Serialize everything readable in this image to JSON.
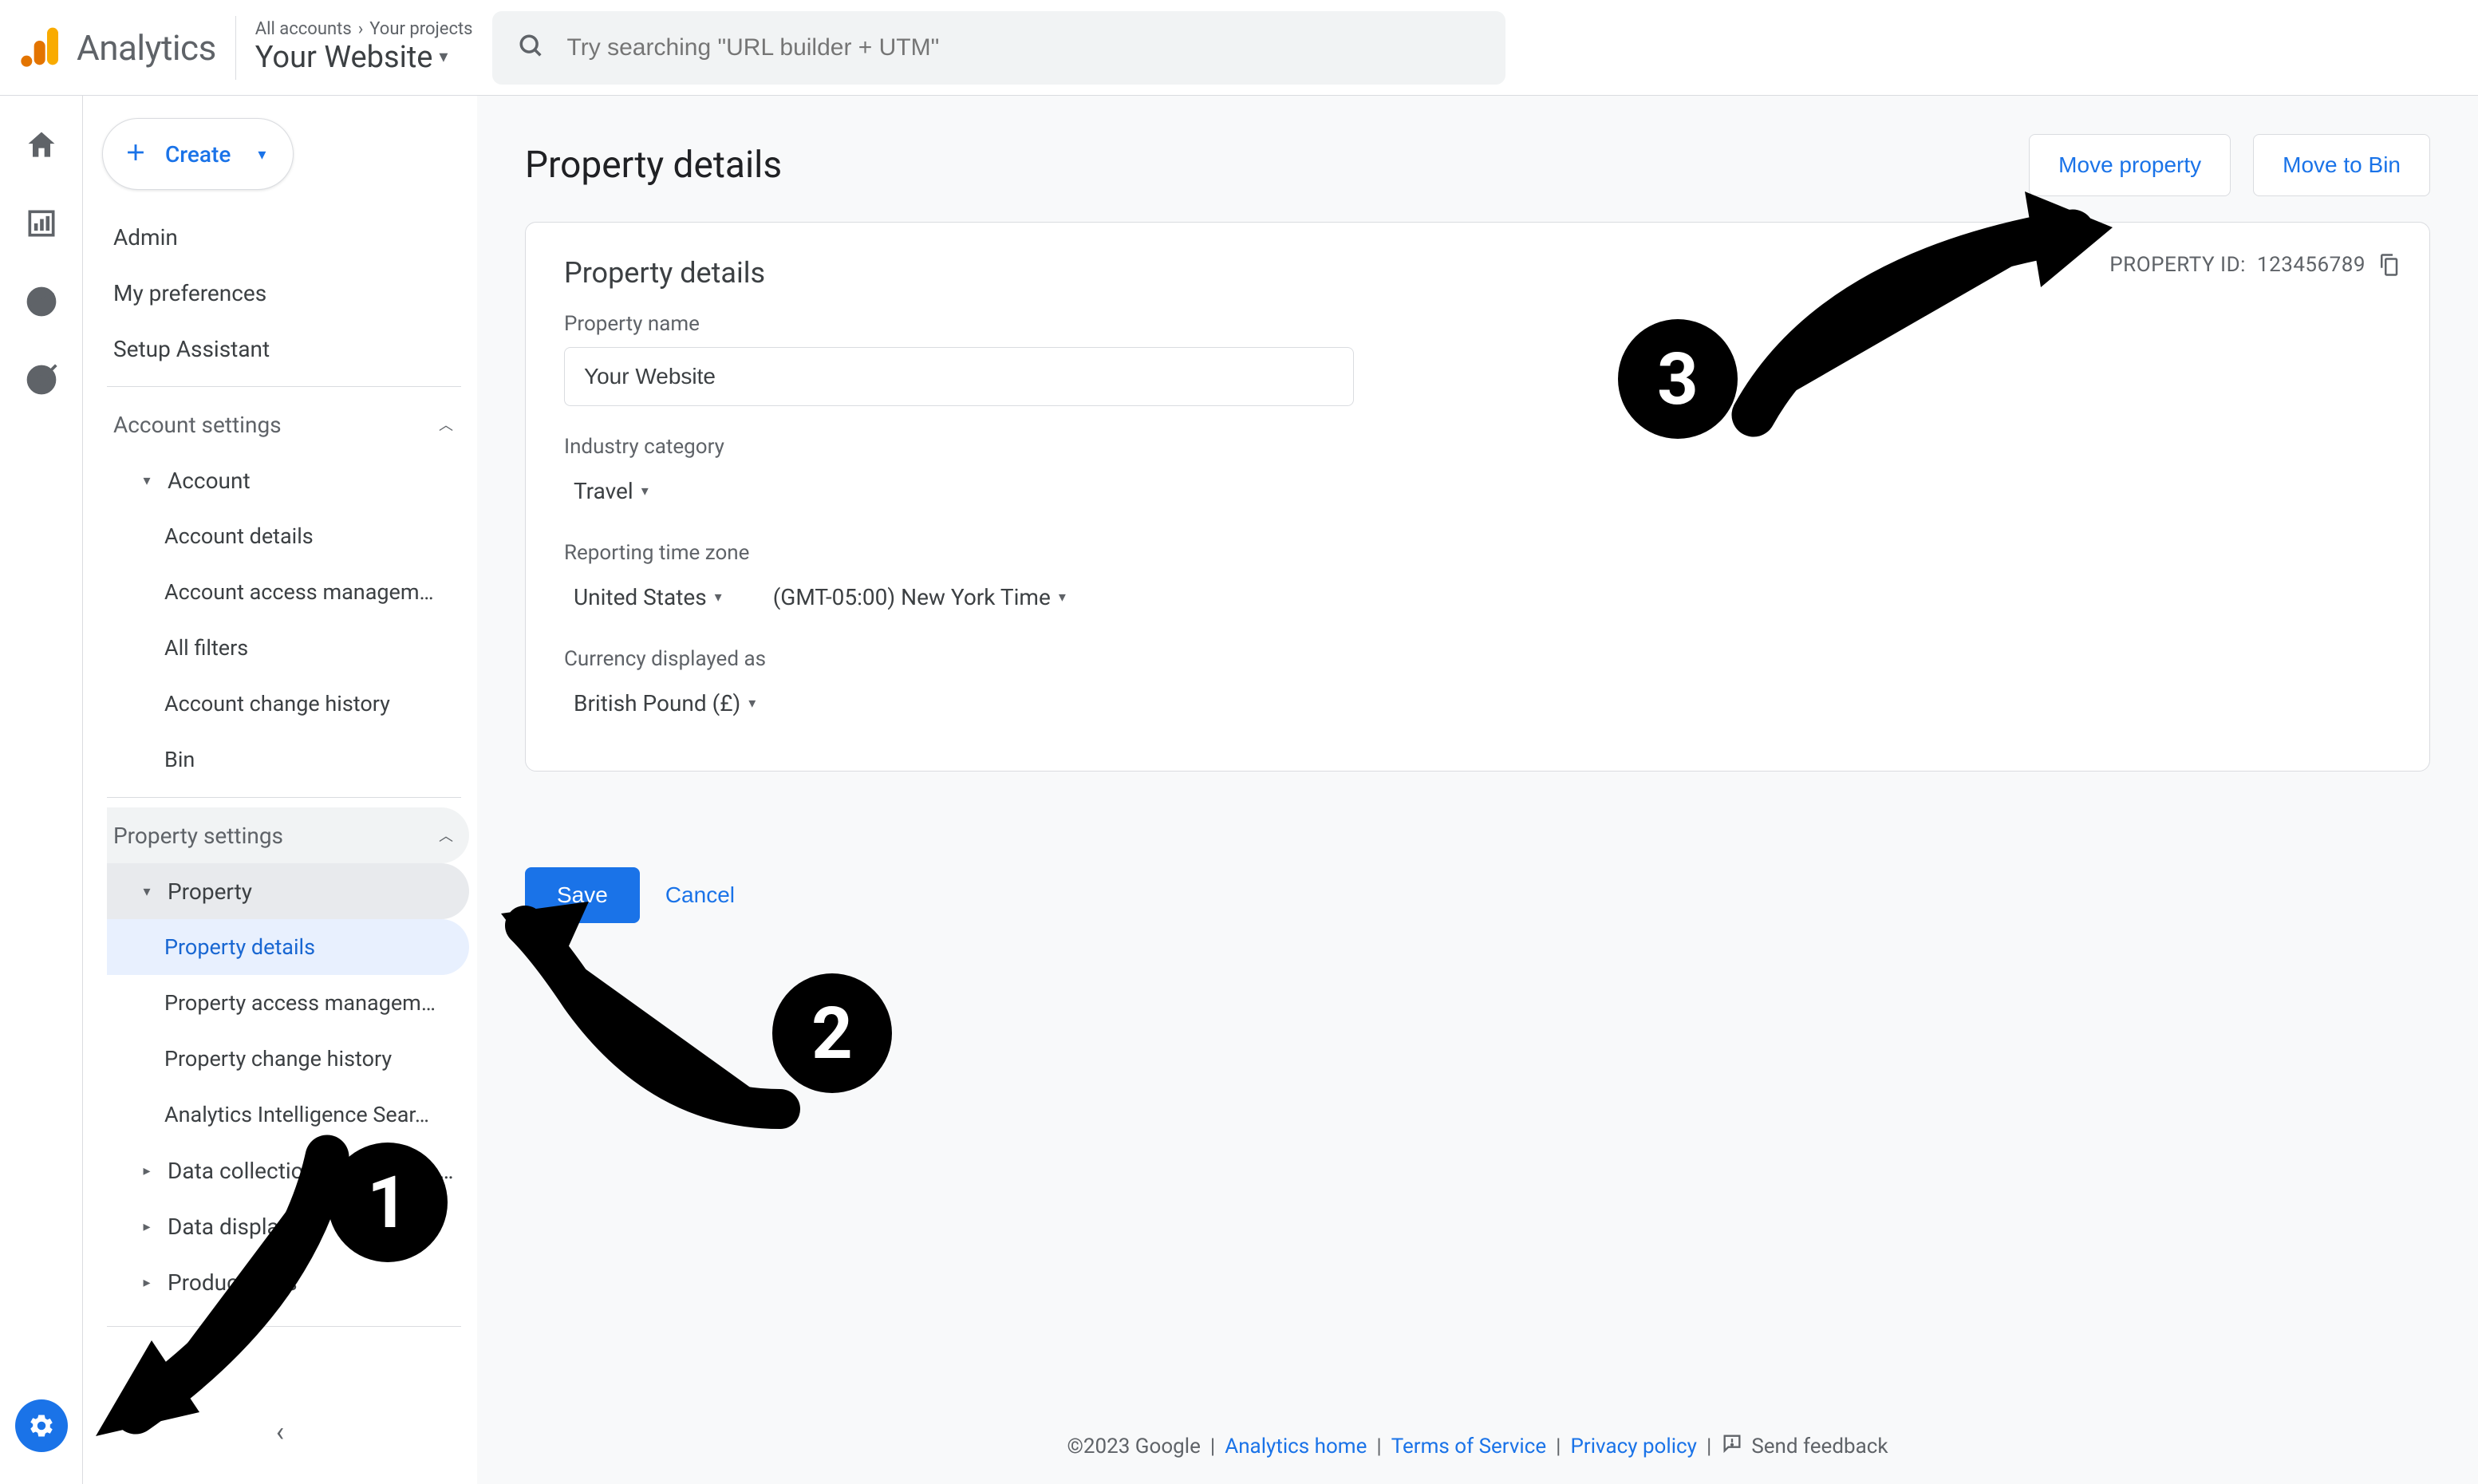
{
  "brand": "Analytics",
  "breadcrumb": {
    "a": "All accounts",
    "b": "Your projects"
  },
  "property_selector": "Your Website",
  "search": {
    "placeholder": "Try searching \"URL builder + UTM\""
  },
  "create_button": "Create",
  "nav": {
    "admin": "Admin",
    "my_prefs": "My preferences",
    "setup_assist": "Setup Assistant",
    "account_settings": "Account settings",
    "account": "Account",
    "account_details": "Account details",
    "account_access": "Account access managem…",
    "all_filters": "All filters",
    "account_change_hist": "Account change history",
    "bin": "Bin",
    "property_settings": "Property settings",
    "property": "Property",
    "property_details": "Property details",
    "property_access": "Property access managem…",
    "property_change_hist": "Property change history",
    "analytics_intel": "Analytics Intelligence Sear…",
    "data_collection": "Data collection and modific…",
    "data_display": "Data display",
    "product_links": "Product links"
  },
  "main": {
    "title": "Property details",
    "move": "Move property",
    "bin": "Move to Bin",
    "card_title": "Property details",
    "property_id_label": "PROPERTY ID:",
    "property_id_value": "123456789",
    "name_label": "Property name",
    "name_value": "Your Website",
    "industry_label": "Industry category",
    "industry_value": "Travel",
    "tz_label": "Reporting time zone",
    "country_value": "United States",
    "tz_value": "(GMT-05:00) New York Time",
    "currency_label": "Currency displayed as",
    "currency_value": "British Pound (£)",
    "save": "Save",
    "cancel": "Cancel"
  },
  "footer": {
    "copyright": "©2023 Google",
    "home": "Analytics home",
    "tos": "Terms of Service",
    "privacy": "Privacy policy",
    "feedback": "Send feedback"
  },
  "annotations": {
    "one": "1",
    "two": "2",
    "three": "3"
  }
}
